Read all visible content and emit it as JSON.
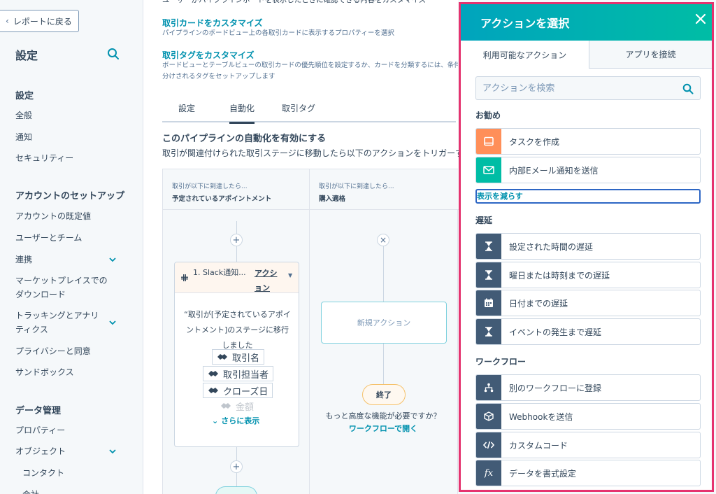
{
  "sidebar": {
    "back_label": "レポートに戻る",
    "title": "設定",
    "sections": [
      {
        "title": "設定",
        "items": [
          "全般",
          "通知",
          "セキュリティー"
        ]
      },
      {
        "title": "アカウントのセットアップ",
        "items": [
          "アカウントの既定値",
          "ユーザーとチーム",
          "連携",
          "マーケットプレイスでのダウンロード",
          "トラッキングとアナリティクス",
          "プライバシーと同意",
          "サンドボックス"
        ]
      },
      {
        "title": "データ管理",
        "items": [
          "プロパティー",
          "オブジェクト",
          "コンタクト",
          "会社"
        ]
      }
    ]
  },
  "main": {
    "top_text": "ユーザーがパイプラインボードを表示したときに確認できる内容をカスタマイズ",
    "links": [
      {
        "title": "取引カードをカスタマイズ",
        "desc": "パイプラインのボードビュー上の各取引カードに表示するプロパティーを選択"
      },
      {
        "title": "取引タグをカスタマイズ",
        "desc": "ボードビューとテーブルビューの取引カードの優先順位を設定するか、カードを分類するには、条件に基づいて取引カードに自動的に適用",
        "desc2": "分けされるタグをセットアップします"
      }
    ],
    "tabs": [
      "設定",
      "自動化",
      "取引タグ"
    ],
    "section_title": "このパイプラインの自動化を有効にする",
    "section_desc": "取引が関連付けられた取引ステージに移動したら以下のアクションをトリガーする",
    "columns": [
      {
        "label": "取引が以下に到達したら...",
        "stage": "予定されているアポイントメント"
      },
      {
        "label": "取引が以下に到達したら...",
        "stage": "購入適格"
      }
    ],
    "card": {
      "name": "1. Slack通知...",
      "action": "アクション",
      "message": "“取引が[予定されているアポイントメント]のステージに移行しました",
      "tokens": [
        "取引名",
        "取引担当者",
        "クローズ日",
        "金額"
      ],
      "more": "さらに表示"
    },
    "new_action": "新規アクション",
    "end": "終了",
    "adv_text": "もっと高度な機能が必要ですか？",
    "wf_link": "ワークフローで開く"
  },
  "panel": {
    "title": "アクションを選択",
    "tabs": [
      "利用可能なアクション",
      "アプリを接続"
    ],
    "search_placeholder": "アクションを検索",
    "groups": [
      {
        "title": "お勧め",
        "actions": [
          {
            "label": "タスクを作成",
            "icon": "task-icon",
            "color": "#ff8f59"
          },
          {
            "label": "内部Eメール通知を送信",
            "icon": "email-icon",
            "color": "#00bda5"
          }
        ]
      },
      {
        "title": "遅延",
        "actions": [
          {
            "label": "設定された時間の遅延",
            "icon": "hourglass-icon",
            "color": "#425b76"
          },
          {
            "label": "曜日または時刻までの遅延",
            "icon": "hourglass-icon",
            "color": "#425b76"
          },
          {
            "label": "日付までの遅延",
            "icon": "calendar-icon",
            "color": "#425b76"
          },
          {
            "label": "イベントの発生まで遅延",
            "icon": "hourglass-icon",
            "color": "#425b76"
          }
        ]
      },
      {
        "title": "ワークフロー",
        "actions": [
          {
            "label": "別のワークフローに登録",
            "icon": "workflow-icon",
            "color": "#425b76"
          },
          {
            "label": "Webhookを送信",
            "icon": "webhook-icon",
            "color": "#425b76"
          },
          {
            "label": "カスタムコード",
            "icon": "code-icon",
            "color": "#425b76"
          },
          {
            "label": "データを書式設定",
            "icon": "function-icon",
            "color": "#425b76"
          }
        ]
      }
    ],
    "show_less": "表示を減らす"
  },
  "colors": {
    "accent": "#0091ae",
    "header_gradient_start": "#00a4bd",
    "header_gradient_end": "#00bda5",
    "highlight_border": "#e5336f"
  }
}
